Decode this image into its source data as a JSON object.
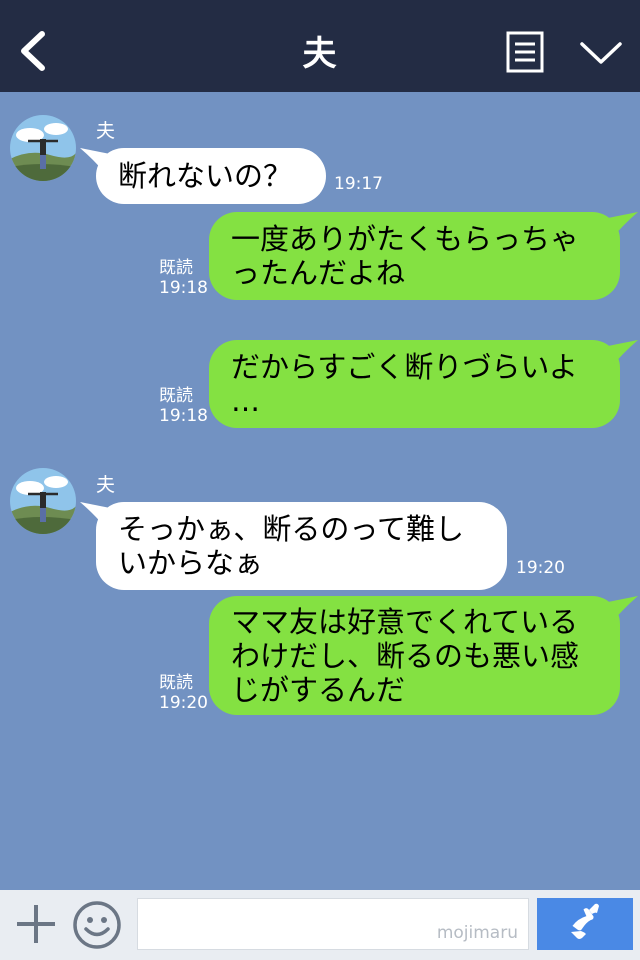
{
  "header": {
    "title": "夫"
  },
  "messages": [
    {
      "side": "in",
      "sender": "夫",
      "text": "断れないの？",
      "time": "19:17"
    },
    {
      "side": "out",
      "lines": [
        "一度ありがたくもらっちゃ",
        "ったんだよね"
      ],
      "read": "既読",
      "time": "19:18"
    },
    {
      "side": "out",
      "lines": [
        "だからすごく断りづらいよ",
        "…"
      ],
      "read": "既読",
      "time": "19:18"
    },
    {
      "side": "in",
      "sender": "夫",
      "lines": [
        "そっかぁ、断るのって難し",
        "いからなぁ"
      ],
      "time": "19:20"
    },
    {
      "side": "out",
      "lines": [
        "ママ友は好意でくれている",
        "わけだし、断るのも悪い感",
        "じがするんだ"
      ],
      "read": "既読",
      "time": "19:20"
    }
  ],
  "input": {
    "watermark": "mojimaru"
  },
  "icons": {
    "back": "chevron-left-icon",
    "notes": "notes-icon",
    "menu": "chevron-down-icon",
    "plus": "plus-icon",
    "emoji": "smiley-icon",
    "call": "phone-icon"
  },
  "colors": {
    "header": "#232c44",
    "chat_bg": "#7292c2",
    "outgoing": "#84e142",
    "incoming": "#ffffff",
    "call_button": "#4a89e5"
  }
}
